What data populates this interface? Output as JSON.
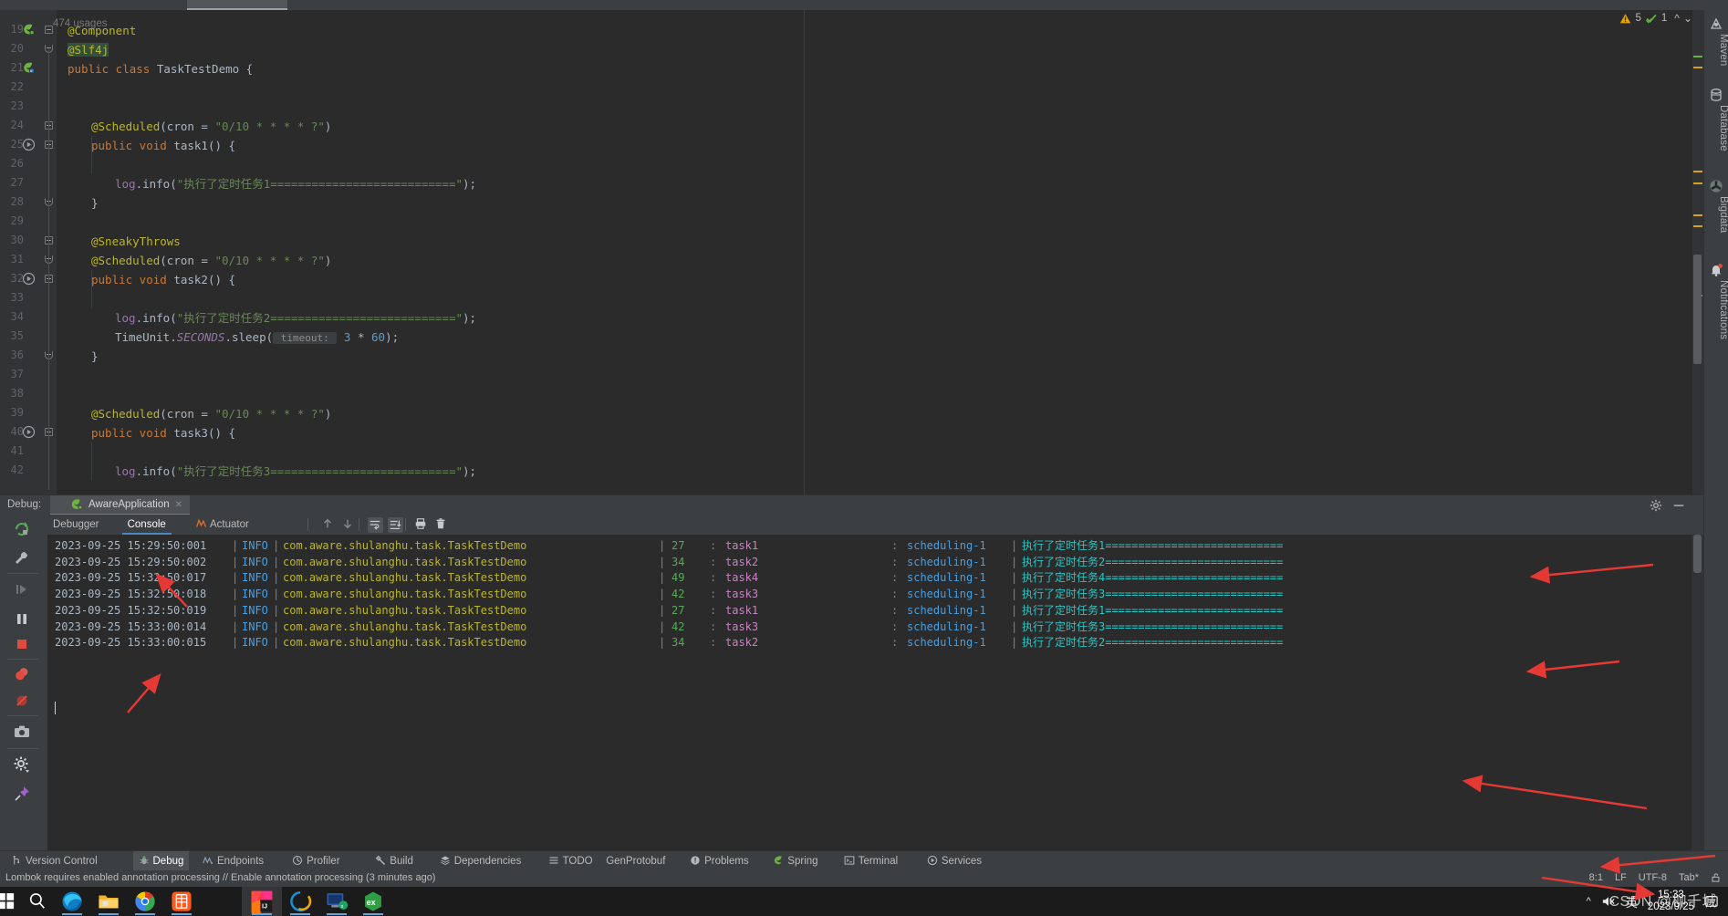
{
  "editor": {
    "usages_label": "474 usages",
    "first_line_number": 19,
    "lines": [
      {
        "n": 19,
        "tokens": [
          {
            "t": "@Component",
            "c": "ann"
          }
        ],
        "indent": 0,
        "gutter_icon": "bean-icon",
        "fold": "closed"
      },
      {
        "n": 20,
        "tokens": [
          {
            "t": "@Slf4j",
            "c": "ann hl-slf4j"
          }
        ],
        "indent": 0,
        "fold": "open"
      },
      {
        "n": 21,
        "tokens": [
          {
            "t": "public class ",
            "c": "k"
          },
          {
            "t": "TaskTestDemo",
            "c": "ident"
          },
          {
            "t": " {",
            "c": "ident"
          }
        ],
        "indent": 0,
        "gutter_icon": "class-icon"
      },
      {
        "n": 22,
        "tokens": [],
        "indent": 0
      },
      {
        "n": 23,
        "tokens": [],
        "indent": 0
      },
      {
        "n": 24,
        "tokens": [
          {
            "t": "@Scheduled",
            "c": "ann"
          },
          {
            "t": "(cron = ",
            "c": "ident"
          },
          {
            "t": "\"0/10 * * * * ?\"",
            "c": "str"
          },
          {
            "t": ")",
            "c": "ident"
          }
        ],
        "indent": 1,
        "fold": "closed"
      },
      {
        "n": 25,
        "tokens": [
          {
            "t": "public void ",
            "c": "k"
          },
          {
            "t": "task1",
            "c": "ident"
          },
          {
            "t": "() {",
            "c": "ident"
          }
        ],
        "indent": 1,
        "gutter_icon": "run-icon",
        "fold": "closed"
      },
      {
        "n": 26,
        "tokens": [],
        "indent": 1
      },
      {
        "n": 27,
        "tokens": [
          {
            "t": "log",
            "c": "fld"
          },
          {
            "t": ".info(",
            "c": "ident"
          },
          {
            "t": "\"执行了定时任务1===========================\"",
            "c": "str"
          },
          {
            "t": ");",
            "c": "ident"
          }
        ],
        "indent": 2
      },
      {
        "n": 28,
        "tokens": [
          {
            "t": "}",
            "c": "ident"
          }
        ],
        "indent": 1,
        "fold": "end"
      },
      {
        "n": 29,
        "tokens": [],
        "indent": 0
      },
      {
        "n": 30,
        "tokens": [
          {
            "t": "@SneakyThrows",
            "c": "ann"
          }
        ],
        "indent": 1,
        "fold": "closed"
      },
      {
        "n": 31,
        "tokens": [
          {
            "t": "@Scheduled",
            "c": "ann"
          },
          {
            "t": "(cron = ",
            "c": "ident"
          },
          {
            "t": "\"0/10 * * * * ?\"",
            "c": "str"
          },
          {
            "t": ")",
            "c": "ident"
          }
        ],
        "indent": 1,
        "fold": "end"
      },
      {
        "n": 32,
        "tokens": [
          {
            "t": "public void ",
            "c": "k"
          },
          {
            "t": "task2",
            "c": "ident"
          },
          {
            "t": "() {",
            "c": "ident"
          }
        ],
        "indent": 1,
        "gutter_icon": "run-icon",
        "fold": "closed"
      },
      {
        "n": 33,
        "tokens": [],
        "indent": 1
      },
      {
        "n": 34,
        "tokens": [
          {
            "t": "log",
            "c": "fld"
          },
          {
            "t": ".info(",
            "c": "ident"
          },
          {
            "t": "\"执行了定时任务2===========================\"",
            "c": "str"
          },
          {
            "t": ");",
            "c": "ident"
          }
        ],
        "indent": 2
      },
      {
        "n": 35,
        "tokens": [
          {
            "t": "TimeUnit",
            "c": "ident"
          },
          {
            "t": ".",
            "c": "ident"
          },
          {
            "t": "SECONDS",
            "c": "static-it"
          },
          {
            "t": ".sleep(",
            "c": "ident"
          },
          {
            "t": " timeout: ",
            "c": "hint"
          },
          {
            "t": " 3 ",
            "c": "num"
          },
          {
            "t": "* ",
            "c": "ident"
          },
          {
            "t": "60",
            "c": "num"
          },
          {
            "t": ");",
            "c": "ident"
          }
        ],
        "indent": 2
      },
      {
        "n": 36,
        "tokens": [
          {
            "t": "}",
            "c": "ident"
          }
        ],
        "indent": 1,
        "fold": "end"
      },
      {
        "n": 37,
        "tokens": [],
        "indent": 0
      },
      {
        "n": 38,
        "tokens": [],
        "indent": 0
      },
      {
        "n": 39,
        "tokens": [
          {
            "t": "@Scheduled",
            "c": "ann"
          },
          {
            "t": "(cron = ",
            "c": "ident"
          },
          {
            "t": "\"0/10 * * * * ?\"",
            "c": "str"
          },
          {
            "t": ")",
            "c": "ident"
          }
        ],
        "indent": 1
      },
      {
        "n": 40,
        "tokens": [
          {
            "t": "public void ",
            "c": "k"
          },
          {
            "t": "task3",
            "c": "ident"
          },
          {
            "t": "() {",
            "c": "ident"
          }
        ],
        "indent": 1,
        "gutter_icon": "run-icon",
        "fold": "closed"
      },
      {
        "n": 41,
        "tokens": [],
        "indent": 1
      },
      {
        "n": 42,
        "tokens": [
          {
            "t": "log",
            "c": "fld"
          },
          {
            "t": ".info(",
            "c": "ident"
          },
          {
            "t": "\"执行了定时任务3===========================\"",
            "c": "str"
          },
          {
            "t": ");",
            "c": "ident"
          }
        ],
        "indent": 2
      }
    ]
  },
  "inspections": {
    "warning_count": "5",
    "ok_count": "1"
  },
  "right_toolbar": [
    {
      "label": "Maven",
      "icon": "maven-icon"
    },
    {
      "label": "Database",
      "icon": "database-icon"
    },
    {
      "label": "Bigdata",
      "icon": "bigdata-icon"
    },
    {
      "label": "Notifications",
      "icon": "bell-icon"
    }
  ],
  "debug_window": {
    "title": "Debug:",
    "session_tab": "AwareApplication",
    "tabs": [
      {
        "label": "Debugger",
        "active": false
      },
      {
        "label": "Console",
        "active": true
      },
      {
        "label": "Actuator",
        "active": false,
        "icon": "actuator-icon"
      }
    ],
    "toolbar_icons": [
      "rerun-icon",
      "settings-wrench-icon",
      "resume-icon",
      "pause-icon",
      "stop-icon",
      "view-breakpoints-icon",
      "mute-breakpoints-icon",
      "screenshot-icon",
      "settings-gear-icon",
      "pin-icon"
    ],
    "console_toolbar_icons": [
      "up-arrow-icon",
      "down-arrow-icon",
      "soft-wrap-icon",
      "scroll-to-end-icon",
      "print-icon",
      "trash-icon"
    ],
    "log_lines": [
      {
        "ts": "2023-09-25 15:29:50:001",
        "level": "INFO",
        "logger": "com.aware.shulanghu.task.TaskTestDemo",
        "line": "27",
        "method": "task1",
        "thread": "scheduling-1",
        "message": "执行了定时任务1==========================="
      },
      {
        "ts": "2023-09-25 15:29:50:002",
        "level": "INFO",
        "logger": "com.aware.shulanghu.task.TaskTestDemo",
        "line": "34",
        "method": "task2",
        "thread": "scheduling-1",
        "message": "执行了定时任务2==========================="
      },
      {
        "ts": "2023-09-25 15:32:50:017",
        "level": "INFO",
        "logger": "com.aware.shulanghu.task.TaskTestDemo",
        "line": "49",
        "method": "task4",
        "thread": "scheduling-1",
        "message": "执行了定时任务4==========================="
      },
      {
        "ts": "2023-09-25 15:32:50:018",
        "level": "INFO",
        "logger": "com.aware.shulanghu.task.TaskTestDemo",
        "line": "42",
        "method": "task3",
        "thread": "scheduling-1",
        "message": "执行了定时任务3==========================="
      },
      {
        "ts": "2023-09-25 15:32:50:019",
        "level": "INFO",
        "logger": "com.aware.shulanghu.task.TaskTestDemo",
        "line": "27",
        "method": "task1",
        "thread": "scheduling-1",
        "message": "执行了定时任务1==========================="
      },
      {
        "ts": "2023-09-25 15:33:00:014",
        "level": "INFO",
        "logger": "com.aware.shulanghu.task.TaskTestDemo",
        "line": "42",
        "method": "task3",
        "thread": "scheduling-1",
        "message": "执行了定时任务3==========================="
      },
      {
        "ts": "2023-09-25 15:33:00:015",
        "level": "INFO",
        "logger": "com.aware.shulanghu.task.TaskTestDemo",
        "line": "34",
        "method": "task2",
        "thread": "scheduling-1",
        "message": "执行了定时任务2==========================="
      }
    ]
  },
  "bottom_bar": [
    {
      "label": "Version Control",
      "icon": "branch-icon",
      "active": false
    },
    {
      "label": "Debug",
      "icon": "debug-icon",
      "active": true
    },
    {
      "label": "Endpoints",
      "icon": "endpoints-icon",
      "active": false
    },
    {
      "label": "Profiler",
      "icon": "profiler-icon",
      "active": false
    },
    {
      "label": "Build",
      "icon": "build-hammer-icon",
      "active": false
    },
    {
      "label": "Dependencies",
      "icon": "dependencies-icon",
      "active": false
    },
    {
      "label": "TODO",
      "icon": "todo-icon",
      "active": false
    },
    {
      "label": "GenProtobuf",
      "icon": "",
      "active": false
    },
    {
      "label": "Problems",
      "icon": "problems-icon",
      "active": false
    },
    {
      "label": "Spring",
      "icon": "spring-leaf-icon",
      "active": false
    },
    {
      "label": "Terminal",
      "icon": "terminal-icon",
      "active": false
    },
    {
      "label": "Services",
      "icon": "services-icon",
      "active": false
    }
  ],
  "status_bar": {
    "message": "Lombok requires enabled annotation processing // Enable annotation processing (3 minutes ago)",
    "caret_position": "8:1",
    "line_separator": "LF",
    "encoding": "UTF-8",
    "indent": "Tab*",
    "lock_icon": "unlocked-icon"
  },
  "taskbar": {
    "items": [
      {
        "name": "start-button",
        "icon": "windows-icon",
        "running": false
      },
      {
        "name": "search",
        "icon": "search-icon",
        "running": false
      },
      {
        "name": "edge",
        "icon": "edge-icon",
        "running": true
      },
      {
        "name": "file-explorer",
        "icon": "folder-icon",
        "running": true
      },
      {
        "name": "chrome",
        "icon": "chrome-icon",
        "running": true
      },
      {
        "name": "dingtalk",
        "icon": "dingtalk-icon",
        "running": true
      },
      {
        "name": "intellij-idea",
        "icon": "idea-icon",
        "running": true,
        "active": true
      },
      {
        "name": "navicat",
        "icon": "navicat-icon",
        "running": true
      },
      {
        "name": "xshell",
        "icon": "xshell-icon",
        "running": true
      },
      {
        "name": "everything",
        "icon": "everything-icon",
        "running": true
      }
    ],
    "tray": {
      "chevron": "show-hidden-icons",
      "volume": "volume-muted-icon",
      "ime": "英",
      "time": "15:33",
      "date": "2023/9/25",
      "notifications": "notification-center-icon"
    }
  },
  "watermark": "CSDN @柳千城",
  "colors": {
    "accent": "#4a88c7",
    "warning": "#e5a50a",
    "ok": "#62b543",
    "console_msg": "#26c6c6",
    "annotation": "#bbb529",
    "keyword": "#cc7832",
    "string": "#6a8759",
    "arrow_red": "#e53935"
  }
}
